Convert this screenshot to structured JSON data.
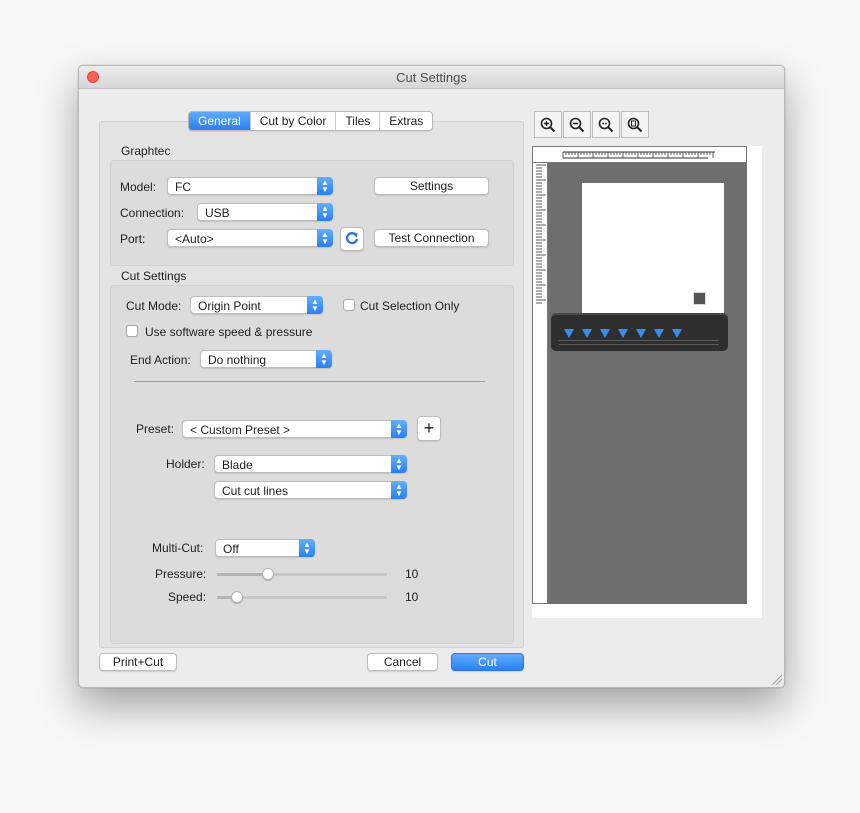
{
  "window": {
    "title": "Cut Settings"
  },
  "tabs": [
    {
      "label": "General",
      "active": true
    },
    {
      "label": "Cut by Color",
      "active": false
    },
    {
      "label": "Tiles",
      "active": false
    },
    {
      "label": "Extras",
      "active": false
    }
  ],
  "graphtec": {
    "title": "Graphtec",
    "model_label": "Model:",
    "model_value": "FC",
    "connection_label": "Connection:",
    "connection_value": "USB",
    "port_label": "Port:",
    "port_value": "<Auto>",
    "settings_button": "Settings",
    "test_connection_button": "Test Connection"
  },
  "cut_settings": {
    "title": "Cut Settings",
    "cut_mode_label": "Cut Mode:",
    "cut_mode_value": "Origin Point",
    "cut_selection_only": "Cut Selection Only",
    "use_software_speed": "Use software speed & pressure",
    "end_action_label": "End Action:",
    "end_action_value": "Do nothing",
    "preset_label": "Preset:",
    "preset_value": "< Custom Preset >",
    "holder_label": "Holder:",
    "holder_value": "Blade",
    "cut_type_value": "Cut cut lines",
    "multicut_label": "Multi-Cut:",
    "multicut_value": "Off",
    "pressure_label": "Pressure:",
    "pressure_value": "10",
    "pressure_level": 0.3,
    "speed_label": "Speed:",
    "speed_value": "10",
    "speed_level": 0.12
  },
  "footer": {
    "print_cut_button": "Print+Cut",
    "cancel_button": "Cancel",
    "cut_button": "Cut"
  },
  "colors": {
    "accent": "#2b7ff5",
    "close": "#fe5f57",
    "roller": "#3a8ee8"
  },
  "zoom_icons": [
    "zoom-in-icon",
    "zoom-out-icon",
    "zoom-fit-icon",
    "zoom-page-icon"
  ]
}
